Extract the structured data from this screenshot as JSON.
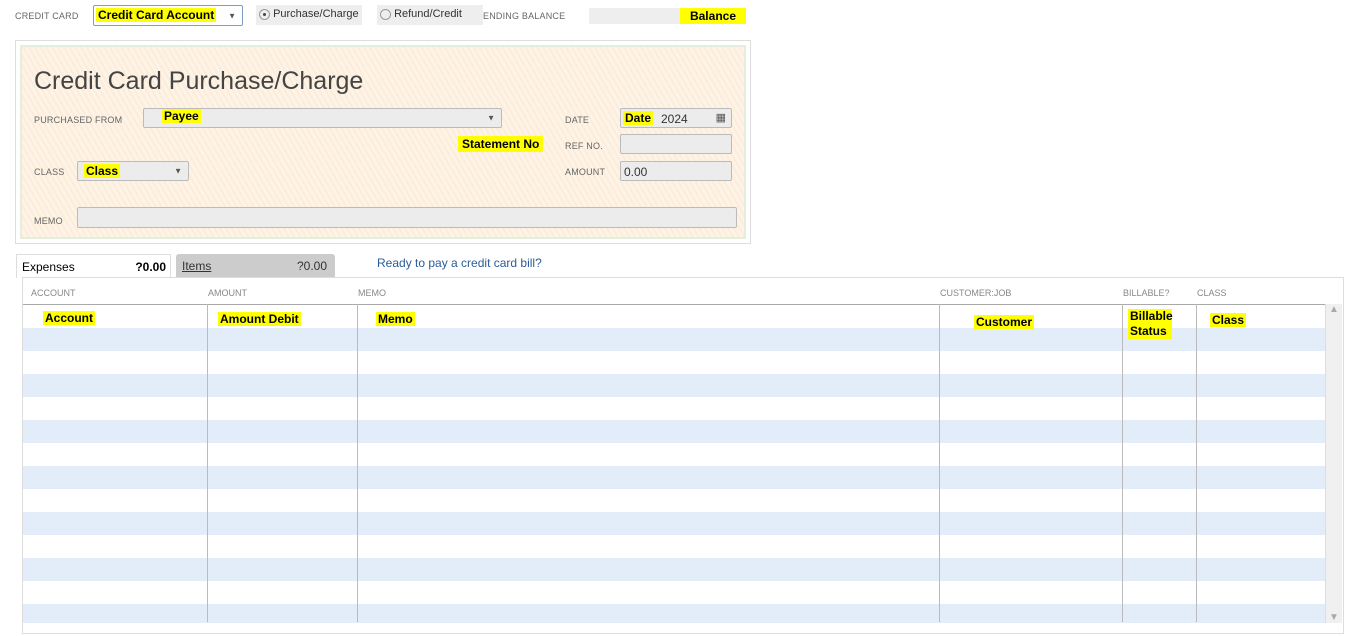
{
  "top": {
    "credit_card_label": "CREDIT CARD",
    "credit_card_value": "Credit Card Account",
    "purchase_label": "Purchase/Charge",
    "refund_label": "Refund/Credit",
    "selected": "Purchase/Charge",
    "ending_balance_label": "ENDING BALANCE",
    "ending_balance_value": "Balance"
  },
  "form": {
    "title": "Credit Card Purchase/Charge",
    "purchased_from_label": "PURCHASED FROM",
    "payee": "Payee",
    "date_label": "DATE",
    "date_tag": "Date",
    "date_value": "2024",
    "statement_no": "Statement No",
    "ref_label": "REF NO.",
    "class_label": "CLASS",
    "class_value": "Class",
    "amount_label": "AMOUNT",
    "amount_value": "0.00",
    "memo_label": "MEMO",
    "memo_value": ""
  },
  "tabs": [
    {
      "label": "Expenses",
      "amount": "?0.00",
      "active": true
    },
    {
      "label": "Items",
      "amount": "?0.00",
      "active": false
    }
  ],
  "link": "Ready to pay a credit card bill?",
  "table": {
    "columns": [
      "ACCOUNT",
      "AMOUNT",
      "MEMO",
      "CUSTOMER:JOB",
      "BILLABLE?",
      "CLASS"
    ],
    "first_row": [
      "Account",
      "Amount Debit",
      "Memo",
      "Customer",
      "Billable Status",
      "Class"
    ]
  },
  "colors": {
    "highlight": "#ffff00",
    "row_alt": "#e3ecf9",
    "link": "#2a5c9a"
  }
}
